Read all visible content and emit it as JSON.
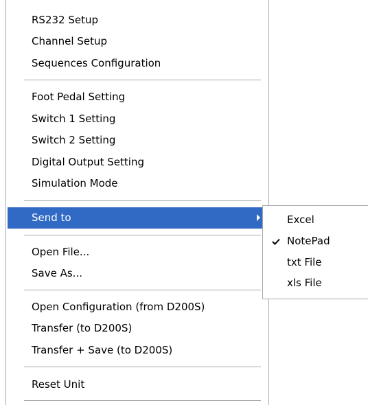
{
  "menu": {
    "items": [
      {
        "label": "RS232 Setup"
      },
      {
        "label": "Channel Setup"
      },
      {
        "label": "Sequences Configuration"
      },
      {
        "label": "Foot Pedal Setting"
      },
      {
        "label": "Switch 1 Setting"
      },
      {
        "label": "Switch 2 Setting"
      },
      {
        "label": "Digital Output Setting"
      },
      {
        "label": "Simulation Mode"
      },
      {
        "label": "Send to",
        "selected": true,
        "has_submenu": true
      },
      {
        "label": "Open File..."
      },
      {
        "label": "Save As..."
      },
      {
        "label": "Open Configuration (from D200S)"
      },
      {
        "label": "Transfer (to D200S)"
      },
      {
        "label": "Transfer + Save (to D200S)"
      },
      {
        "label": "Reset Unit"
      }
    ]
  },
  "submenu": {
    "items": [
      {
        "label": "Excel"
      },
      {
        "label": "NotePad",
        "checked": true
      },
      {
        "label": "txt File"
      },
      {
        "label": "xls File"
      }
    ]
  },
  "colors": {
    "highlight": "#316ac5",
    "border": "#a7a6aa"
  },
  "icons": {
    "submenu_arrow": "chevron-right-icon",
    "checked": "checkmark-icon"
  }
}
